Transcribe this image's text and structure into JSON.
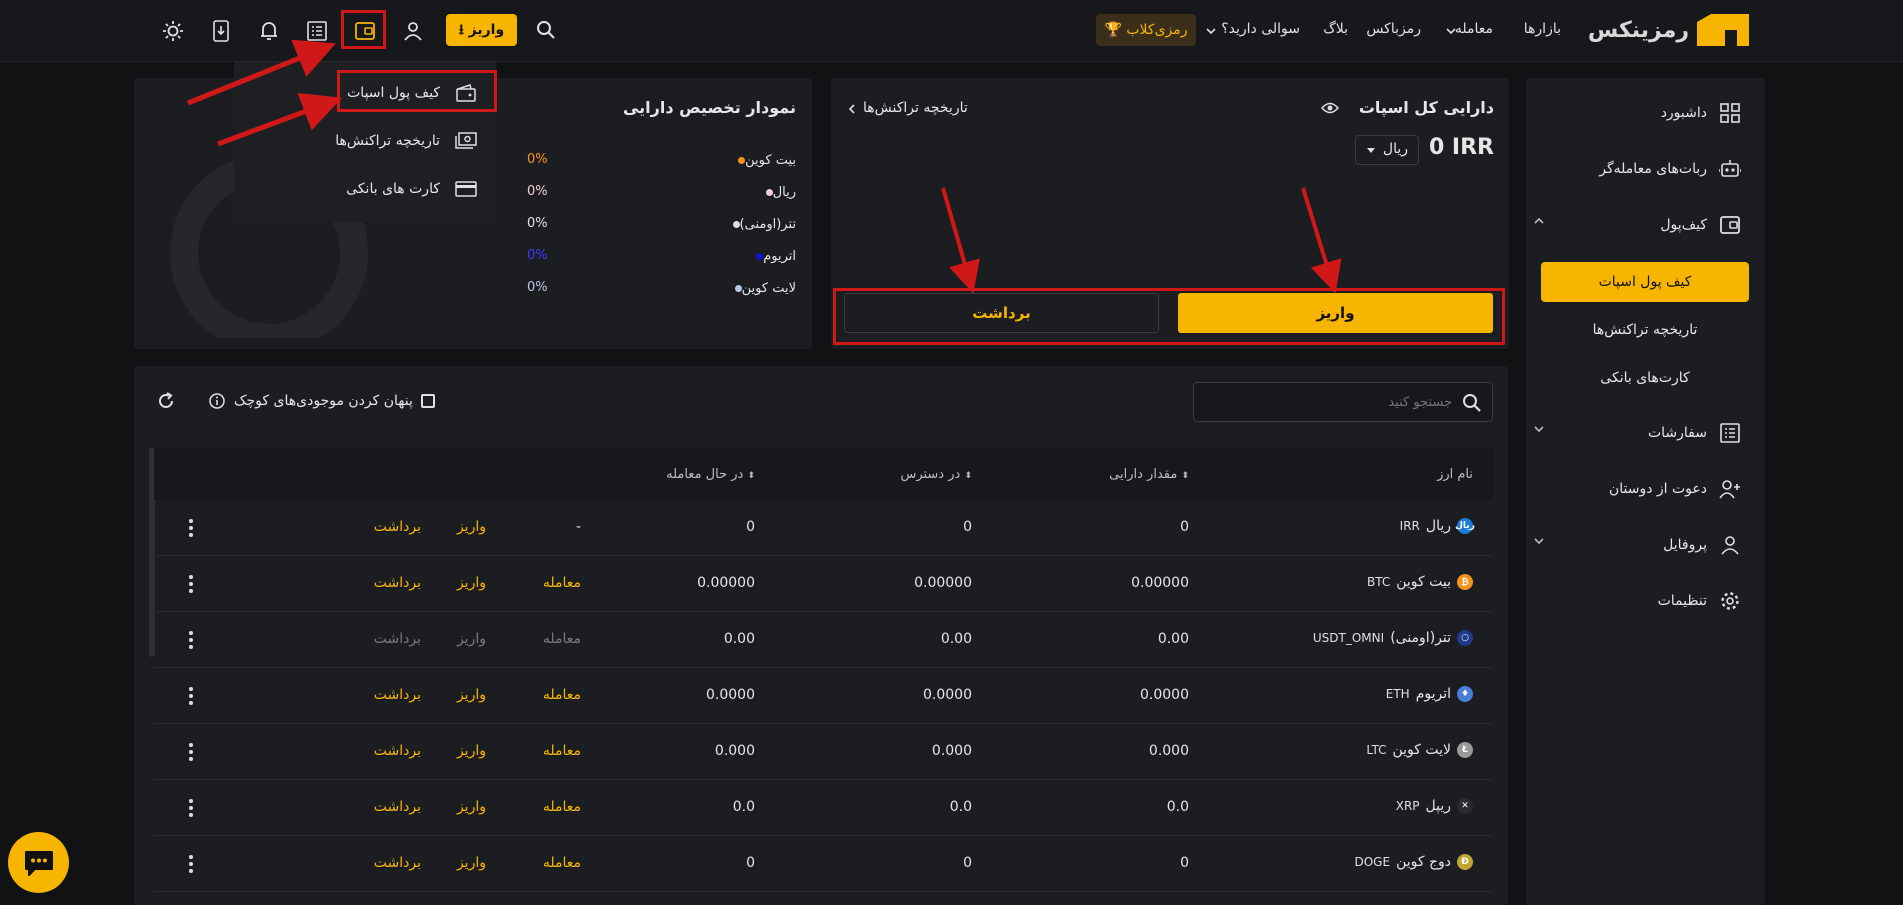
{
  "brand": {
    "name": "رمزینکس"
  },
  "nav": {
    "markets": "بازارها",
    "trade": "معامله",
    "ramzibox": "رمزباکس",
    "blog": "بلاگ",
    "faq": "سوالی دارید؟",
    "club": "رمزی‌کلاب",
    "deposit": "واریز"
  },
  "sidebar": {
    "dashboard": "داشبورد",
    "bots": "ربات‌های معامله‌گر",
    "wallet": "کیف‌پول",
    "wallet_spot": "کیف پول اسپات",
    "wallet_history": "تاریخچه تراکنش‌ها",
    "wallet_cards": "کارت‌های بانکی",
    "orders": "سفارشات",
    "invite": "دعوت از دوستان",
    "profile": "پروفایل",
    "settings": "تنظیمات"
  },
  "dropdown": {
    "spot": "کیف پول اسپات",
    "history": "تاریخچه تراکنش‌ها",
    "cards": "کارت های بانکی"
  },
  "balance": {
    "title": "دارایی کل اسپات",
    "history_link": "تاریخچه تراکنش‌ها",
    "amount": "0 IRR",
    "currency": "ریال",
    "deposit": "واریز",
    "withdraw": "برداشت"
  },
  "allocation": {
    "title": "نمودار تخصیص دارایی",
    "items": [
      {
        "name": "بیت کوین",
        "percent": "0%",
        "color": "#f7931a"
      },
      {
        "name": "ریال",
        "percent": "0%",
        "color": "#f3cfd6"
      },
      {
        "name": "تتر(اومنی)",
        "percent": "0%",
        "color": "#e0e0e0"
      },
      {
        "name": "اتریوم",
        "percent": "0%",
        "color": "#1414d8"
      },
      {
        "name": "لایت کوین",
        "percent": "0%",
        "color": "#b9c7e6"
      }
    ]
  },
  "toolbar": {
    "search_placeholder": "جستجو کنید",
    "hide_small": "پنهان کردن موجودی‌های کوچک"
  },
  "table": {
    "headers": {
      "name": "نام ارز",
      "amount": "مقدار دارایی",
      "available": "در دسترس",
      "in_trade": "در حال معامله"
    },
    "rows": [
      {
        "name": "ریال",
        "sym": "IRR",
        "amount": "0",
        "available": "0",
        "in_trade": "0",
        "trade": "-",
        "deposit": "واریز",
        "withdraw": "برداشت",
        "icon_color": "#1e7ad8",
        "icon_text": "ریال",
        "dim": false
      },
      {
        "name": "بیت کوین",
        "sym": "BTC",
        "amount": "0.00000",
        "available": "0.00000",
        "in_trade": "0.00000",
        "trade": "معامله",
        "deposit": "واریز",
        "withdraw": "برداشت",
        "icon_color": "#f7931a",
        "icon_text": "₿",
        "dim": false
      },
      {
        "name": "تتر(اومنی)",
        "sym": "USDT_OMNI",
        "amount": "0.00",
        "available": "0.00",
        "in_trade": "0.00",
        "trade": "معامله",
        "deposit": "واریز",
        "withdraw": "برداشت",
        "icon_color": "#1f3a8a",
        "icon_text": "○",
        "dim": true
      },
      {
        "name": "اتریوم",
        "sym": "ETH",
        "amount": "0.0000",
        "available": "0.0000",
        "in_trade": "0.0000",
        "trade": "معامله",
        "deposit": "واریز",
        "withdraw": "برداشت",
        "icon_color": "#4a7fd6",
        "icon_text": "♦",
        "dim": false
      },
      {
        "name": "لایت کوین",
        "sym": "LTC",
        "amount": "0.000",
        "available": "0.000",
        "in_trade": "0.000",
        "trade": "معامله",
        "deposit": "واریز",
        "withdraw": "برداشت",
        "icon_color": "#9a9a9a",
        "icon_text": "Ł",
        "dim": false
      },
      {
        "name": "ریپل",
        "sym": "XRP",
        "amount": "0.0",
        "available": "0.0",
        "in_trade": "0.0",
        "trade": "معامله",
        "deposit": "واریز",
        "withdraw": "برداشت",
        "icon_color": "#2a2b30",
        "icon_text": "✕",
        "dim": false
      },
      {
        "name": "دوج کوین",
        "sym": "DOGE",
        "amount": "0",
        "available": "0",
        "in_trade": "0",
        "trade": "معامله",
        "deposit": "واریز",
        "withdraw": "برداشت",
        "icon_color": "#c2a633",
        "icon_text": "Ð",
        "dim": false
      }
    ]
  },
  "colors": {
    "accent": "#f7b500",
    "annotation": "#d01818",
    "bg": "#111214",
    "panel": "#1c1d21"
  }
}
